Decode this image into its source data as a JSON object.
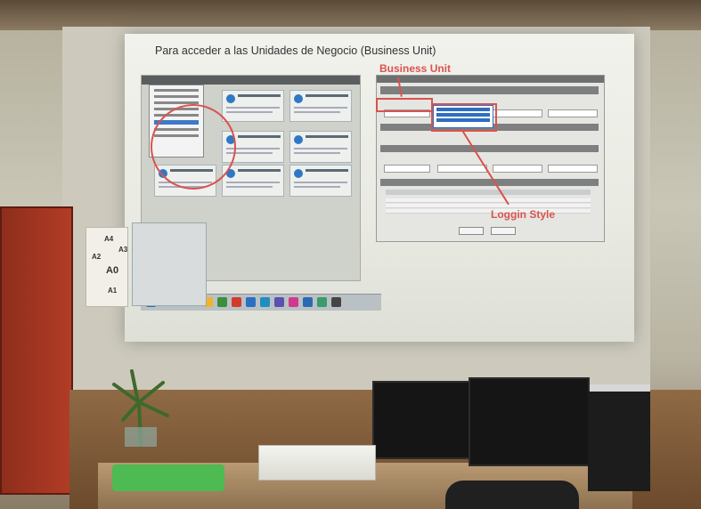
{
  "slide": {
    "title": "Para acceder a las Unidades de Negocio (Business Unit)"
  },
  "annotations": {
    "business_unit": "Business Unit",
    "loggin_style": "Loggin Style"
  },
  "wall_paper": {
    "labels": [
      "A4",
      "A3",
      "A2",
      "A0",
      "A1"
    ]
  },
  "colors": {
    "highlight_red": "#d9534f",
    "accent_blue": "#2e78c6",
    "screen_bg": "#eeefe8"
  }
}
